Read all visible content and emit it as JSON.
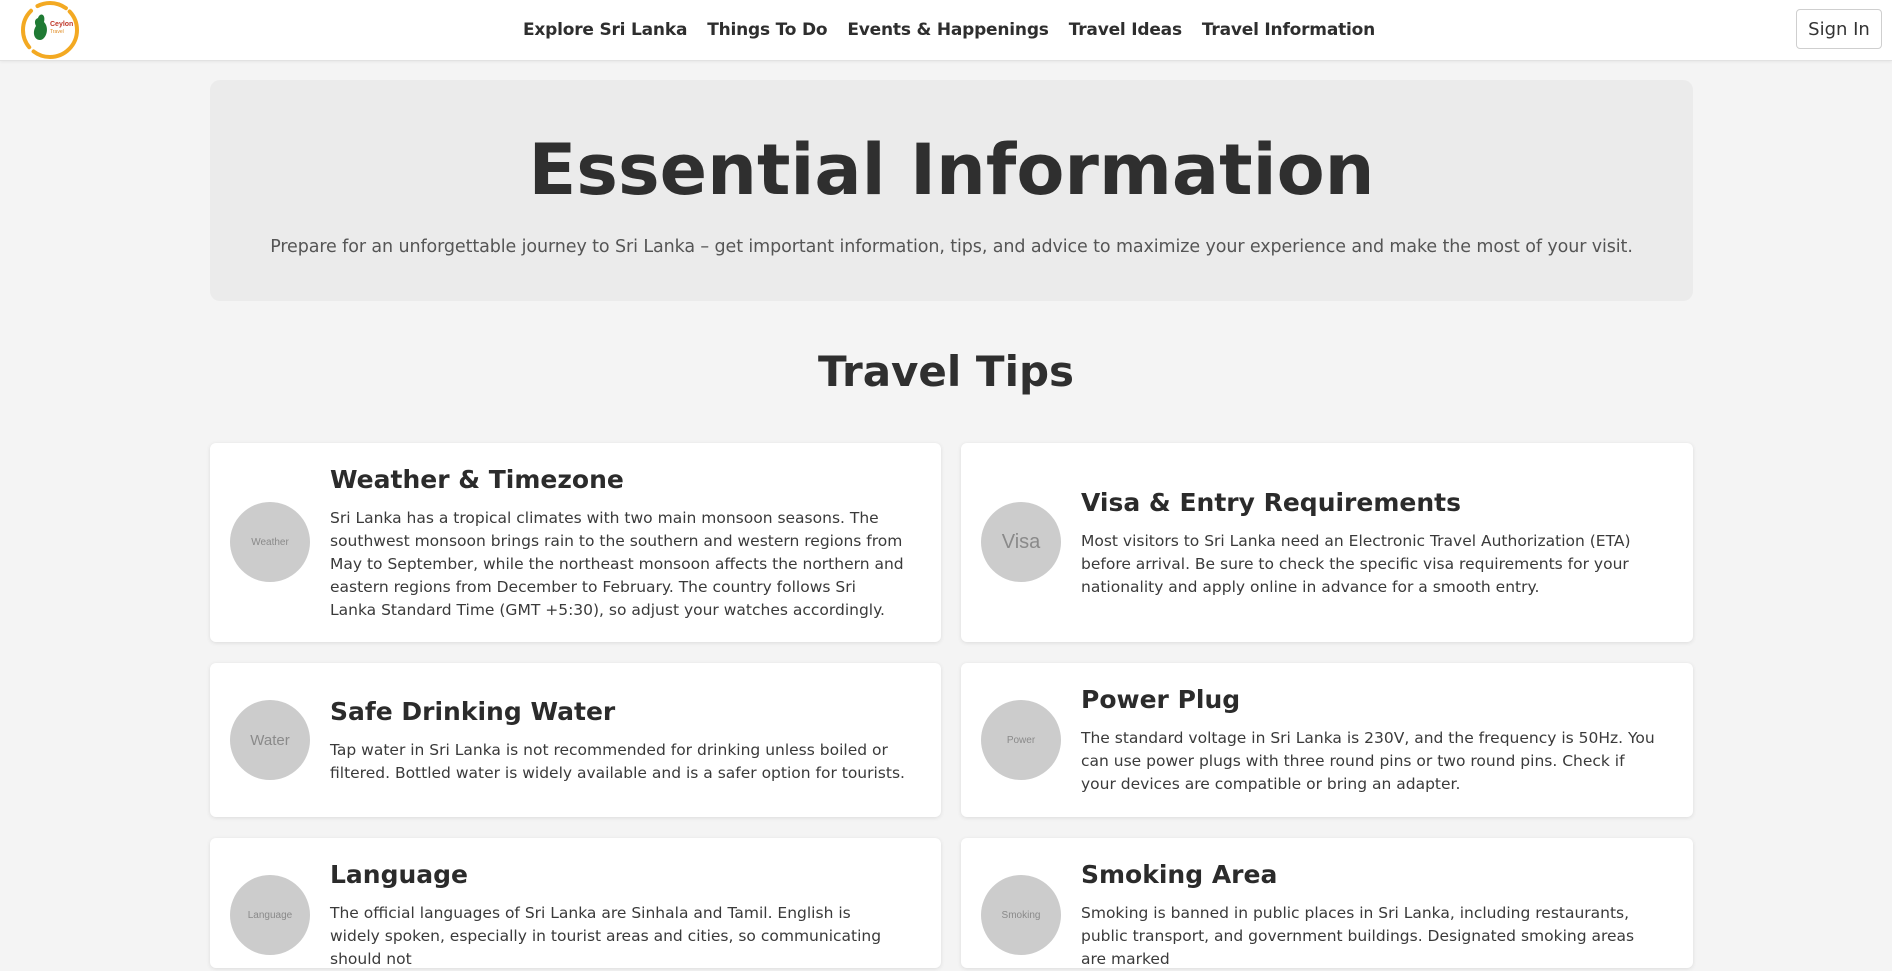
{
  "header": {
    "logo_text": "Ceylon",
    "logo_subtext": "Travel",
    "nav": [
      {
        "label": "Explore Sri Lanka"
      },
      {
        "label": "Things To Do"
      },
      {
        "label": "Events & Happenings"
      },
      {
        "label": "Travel Ideas"
      },
      {
        "label": "Travel Information"
      }
    ],
    "signin_label": "Sign In"
  },
  "hero": {
    "title": "Essential Information",
    "subtitle": "Prepare for an unforgettable journey to Sri Lanka – get important information, tips, and advice to maximize your experience and make the most of your visit."
  },
  "section": {
    "title": "Travel Tips"
  },
  "cards": [
    {
      "icon_label": "Weather",
      "title": "Weather & Timezone",
      "text": "Sri Lanka has a tropical climates with two main monsoon seasons. The southwest monsoon brings rain to the southern and western regions from May to September, while the northeast monsoon affects the northern and eastern regions from December to February. The country follows Sri Lanka Standard Time (GMT +5:30), so adjust your watches accordingly."
    },
    {
      "icon_label": "Visa",
      "title": "Visa & Entry Requirements",
      "text": "Most visitors to Sri Lanka need an Electronic Travel Authorization (ETA) before arrival. Be sure to check the specific visa requirements for your nationality and apply online in advance for a smooth entry."
    },
    {
      "icon_label": "Water",
      "title": "Safe Drinking Water",
      "text": "Tap water in Sri Lanka is not recommended for drinking unless boiled or filtered. Bottled water is widely available and is a safer option for tourists."
    },
    {
      "icon_label": "Power",
      "title": "Power Plug",
      "text": "The standard voltage in Sri Lanka is 230V, and the frequency is 50Hz. You can use power plugs with three round pins or two round pins. Check if your devices are compatible or bring an adapter."
    },
    {
      "icon_label": "Language",
      "title": "Language",
      "text": "The official languages of Sri Lanka are Sinhala and Tamil. English is widely spoken, especially in tourist areas and cities, so communicating should not"
    },
    {
      "icon_label": "Smoking",
      "title": "Smoking Area",
      "text": "Smoking is banned in public places in Sri Lanka, including restaurants, public transport, and government buildings. Designated smoking areas are marked"
    }
  ],
  "colors": {
    "page_bg": "#f4f4f4",
    "hero_bg": "#ebebeb",
    "logo_ring": "#f3a922",
    "logo_leaf": "#1f7a34",
    "logo_text": "#c0392b",
    "icon_circle": "#cccccc"
  }
}
